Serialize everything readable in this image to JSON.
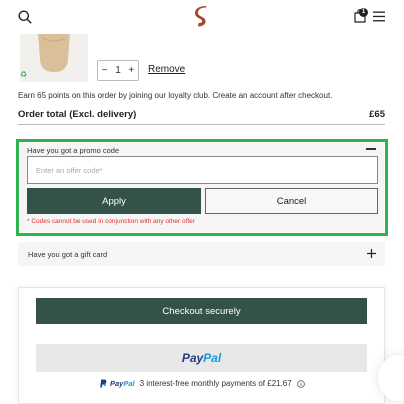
{
  "header": {
    "icons": {
      "search": "search-icon",
      "logo": "brand-logo",
      "bag": "bag-icon",
      "menu": "menu-icon"
    },
    "bag_count": "1"
  },
  "basket": {
    "item": {
      "image": "handbag-product-image",
      "badge_icon": "recycle-icon",
      "quantity": "1",
      "decrement_label": "−",
      "increment_label": "+",
      "remove_label": "Remove"
    },
    "loyalty_text": "Earn 65 points on this order by joining our loyalty club. Create an account after checkout.",
    "total_label": "Order total (Excl. delivery)",
    "total_value": "£65"
  },
  "promo": {
    "title": "Have you got a promo code",
    "input_placeholder": "Enter an offer code*",
    "input_value": "",
    "apply_label": "Apply",
    "cancel_label": "Cancel",
    "note": "* Codes cannot be used in conjunction with any other offer"
  },
  "gift_card": {
    "label": "Have you got a gift card",
    "toggle_icon": "plus-icon"
  },
  "checkout": {
    "checkout_label": "Checkout securely",
    "paypal_label_1": "Pay",
    "paypal_label_2": "Pal",
    "paypal_credit_pay": "Pay",
    "paypal_credit_pal": "Pal",
    "paypal_credit_text": "3 interest-free monthly payments of £21.67"
  },
  "colors": {
    "accent": "#34524a",
    "highlight": "#2db44c",
    "error": "#e03030",
    "paypal_dark": "#253b80",
    "paypal_light": "#179bd7",
    "brand_logo": "#a8452f"
  }
}
